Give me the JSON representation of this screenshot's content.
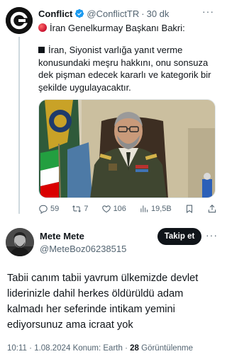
{
  "quoted_tweet": {
    "author_name": "Conflict",
    "handle": "@ConflictTR",
    "separator": "·",
    "time": "30 dk",
    "more_glyph": "···",
    "headline": "İran Genelkurmay Başkanı Bakri:",
    "body": "İran, Siyonist varlığa yanıt verme konusundaki meşru hakkını, onu sonsuza dek pişman edecek kararlı ve kategorik bir şekilde uygulayacaktır.",
    "verified_color": "#1d9bf0",
    "actions": {
      "replies": "59",
      "retweets": "7",
      "likes": "106",
      "views": "19,5B"
    }
  },
  "reply_tweet": {
    "author_name": "Mete Mete",
    "handle": "@MeteBoz06238515",
    "follow_label": "Takip et",
    "more_glyph": "···",
    "text": "Tabii canım tabii yavrum ülkemizde devlet liderinizle dahil herkes öldürüldü adam kalmadı her seferinde intikam yemini ediyorsunuz ama icraat yok",
    "meta": {
      "time": "10:11",
      "separator": "·",
      "date": "1.08.2024",
      "location": "Konum: Earth",
      "views_count": "28",
      "views_label": "Görüntülenme"
    }
  },
  "colors": {
    "text_primary": "#0f1419",
    "text_secondary": "#536471",
    "follow_button_bg": "#0f1419",
    "alert_red": "#c8102e"
  }
}
